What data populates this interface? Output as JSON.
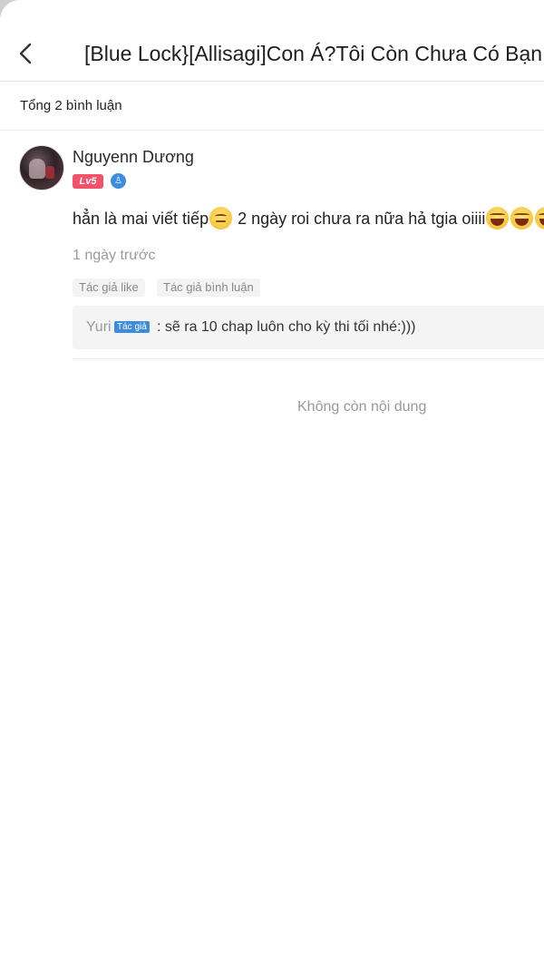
{
  "header": {
    "title": "[Blue Lock}[Allisagi]Con Á?Tôi Còn Chưa Có Bạn"
  },
  "summary": {
    "total_comments": "Tổng 2 bình luận"
  },
  "comment": {
    "username": "Nguyenn Dương",
    "level": "Lv5",
    "text_part1": "hẳn là mai viết tiếp",
    "text_part2": " 2 ngày roi chưa ra nữa hả tgia oiiii",
    "time": "1 ngày trước",
    "tags": [
      "Tác giả like",
      "Tác giả bình luận"
    ],
    "reply": {
      "author": "Yuri",
      "author_tag": "Tác giả",
      "text": ": sẽ ra 10 chap luôn cho kỳ thi tối nhé:)))"
    }
  },
  "footer": {
    "end_text": "Không còn nội dung"
  },
  "icons": {
    "back": "chevron-left-icon",
    "verify": "verified-icon",
    "emoji_smirk": "smirk-emoji-icon",
    "emoji_laugh": "laughing-emoji-icon"
  },
  "colors": {
    "level_badge": "#f4526b",
    "author_tag": "#3d8ddc",
    "muted_text": "#9a9a9a"
  }
}
